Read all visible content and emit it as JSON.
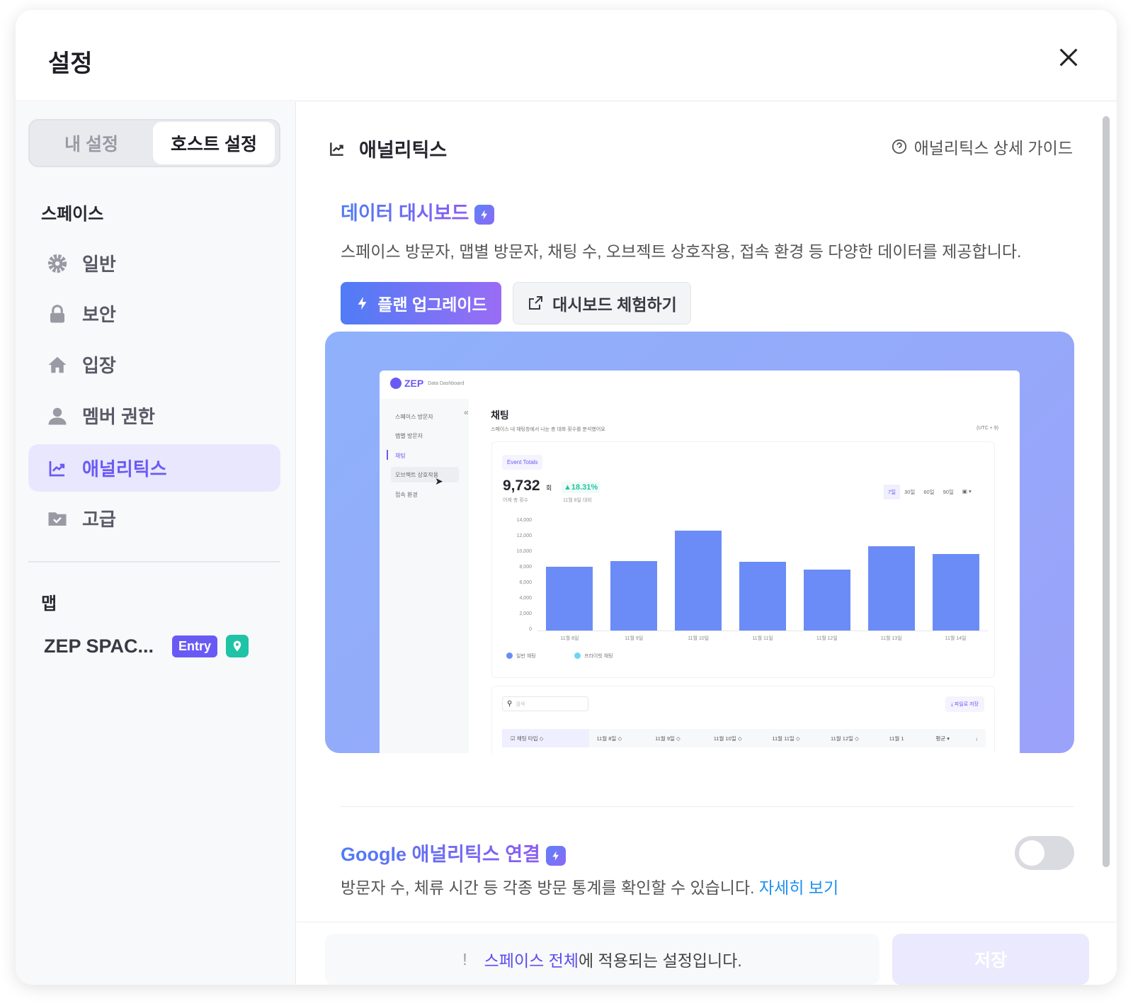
{
  "header": {
    "title": "설정",
    "close_icon": "close-icon"
  },
  "sidebar": {
    "tabs": [
      {
        "label": "내 설정",
        "active": false
      },
      {
        "label": "호스트 설정",
        "active": true
      }
    ],
    "space_section": "스페이스",
    "items": [
      {
        "label": "일반",
        "icon": "gear-icon"
      },
      {
        "label": "보안",
        "icon": "lock-icon"
      },
      {
        "label": "입장",
        "icon": "home-icon"
      },
      {
        "label": "멤버 권한",
        "icon": "user-icon"
      },
      {
        "label": "애널리틱스",
        "icon": "analytics-icon",
        "active": true
      },
      {
        "label": "고급",
        "icon": "folder-check-icon"
      }
    ],
    "map_section": "맵",
    "map": {
      "name": "ZEP SPAC...",
      "badge": "Entry",
      "pin_icon": "map-pin-icon"
    }
  },
  "main": {
    "title": "애널리틱스",
    "guide_link": "애널리틱스 상세 가이드",
    "dashboard": {
      "title": "데이터 대시보드",
      "description": "스페이스 방문자, 맵별 방문자, 채팅 수, 오브젝트 상호작용, 접속 환경 등 다양한 데이터를 제공합니다.",
      "upgrade_button": "플랜 업그레이드",
      "try_button": "대시보드 체험하기"
    },
    "google": {
      "title": "Google 애널리틱스 연결",
      "description": "방문자 수, 체류 시간 등 각종 방문 통계를 확인할 수 있습니다.",
      "link": "자세히 보기",
      "enabled": false
    },
    "footer": {
      "notice_highlight": "스페이스 전체",
      "notice_rest": "에 적용되는 설정입니다.",
      "notice_icon": "!",
      "save": "저장"
    }
  },
  "preview": {
    "brand": "ZEP",
    "brand_sub": "Data Dashboard",
    "nav": [
      "스페이스 방문자",
      "맵별 방문자",
      "채팅",
      "오브젝트 상호작용",
      "접속 환경"
    ],
    "collapse": "«",
    "page_title": "채팅",
    "page_sub": "스페이스 내 채팅창에서 나눈 총 대화 횟수를 분석했어요",
    "timezone": "(UTC + 9)",
    "chip": "Event Totals",
    "total": "9,732",
    "total_unit": "회",
    "change": "▲18.31%",
    "total_label": "어제 총 횟수",
    "change_label": "11월 8일 대비",
    "periods": [
      "7일",
      "30일",
      "60일",
      "90일"
    ],
    "search_placeholder": "검색",
    "export": "⤓ 파일로 저장",
    "table_headers": [
      "채팅 타입",
      "11월 8일",
      "11월 9일",
      "11월 10일",
      "11월 11일",
      "11월 12일",
      "11월 1",
      "평균 ▾"
    ]
  },
  "chart_data": {
    "type": "bar",
    "categories": [
      "11월 8일",
      "11월 9일",
      "11월 10일",
      "11월 11일",
      "11월 12일",
      "11월 13일",
      "11월 14일"
    ],
    "series": [
      {
        "name": "일반 채팅",
        "values": [
          8200,
          8900,
          12800,
          8800,
          7800,
          10800,
          9800
        ],
        "color": "#6b8cf6"
      },
      {
        "name": "프라이빗 채팅",
        "values": [
          0,
          0,
          0,
          0,
          0,
          0,
          0
        ],
        "color": "#6ad8f0"
      }
    ],
    "yticks": [
      "0",
      "2,000",
      "4,000",
      "6,000",
      "8,000",
      "10,000",
      "12,000",
      "14,000"
    ],
    "ylim": [
      0,
      14000
    ]
  }
}
